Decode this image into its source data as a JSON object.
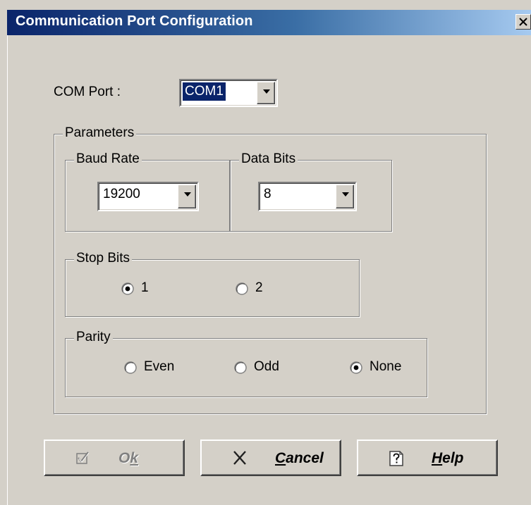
{
  "window": {
    "title": "Communication Port Configuration",
    "close_icon": "close-x"
  },
  "com_port": {
    "label": "COM Port  :",
    "value": "COM1"
  },
  "parameters": {
    "legend": "Parameters",
    "baud_rate": {
      "legend": "Baud Rate",
      "value": "19200"
    },
    "data_bits": {
      "legend": "Data Bits",
      "value": "8"
    },
    "stop_bits": {
      "legend": "Stop Bits",
      "options": [
        {
          "label": "1",
          "selected": true
        },
        {
          "label": "2",
          "selected": false
        }
      ]
    },
    "parity": {
      "legend": "Parity",
      "options": [
        {
          "label": "Even",
          "selected": false
        },
        {
          "label": "Odd",
          "selected": false
        },
        {
          "label": "None",
          "selected": true
        }
      ]
    }
  },
  "buttons": {
    "ok": {
      "label": "Ok",
      "icon": "check-icon",
      "enabled": false
    },
    "cancel": {
      "label": "Cancel",
      "icon": "x-icon",
      "enabled": true
    },
    "help": {
      "label": "Help",
      "icon": "help-question-icon",
      "enabled": true
    }
  },
  "colors": {
    "titlebar_start": "#0a246a",
    "titlebar_end": "#a6caf0",
    "dialog_face": "#d4d0c8",
    "selection": "#0a246a"
  }
}
